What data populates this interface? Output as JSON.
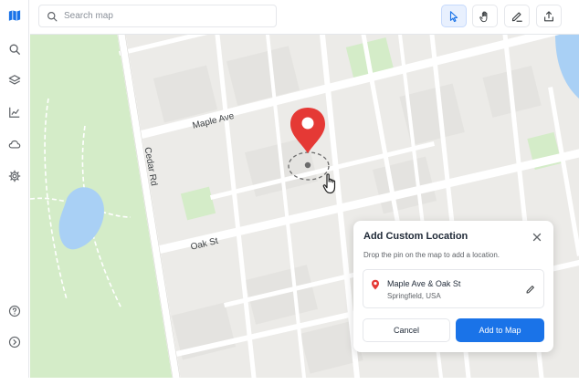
{
  "sidebar": {
    "items": [
      {
        "icon": "map-icon",
        "active": true
      },
      {
        "icon": "search-icon"
      },
      {
        "icon": "layers-icon"
      },
      {
        "icon": "analytics-icon"
      },
      {
        "icon": "cloud-icon"
      },
      {
        "icon": "settings-icon"
      },
      {
        "icon": "help-icon"
      },
      {
        "icon": "expand-icon"
      }
    ]
  },
  "toolbar": {
    "search_placeholder": "Search map",
    "tools": [
      {
        "icon": "pointer-icon",
        "active": true
      },
      {
        "icon": "pan-hand-icon"
      },
      {
        "icon": "draw-icon"
      },
      {
        "icon": "share-icon"
      }
    ]
  },
  "map": {
    "streets": {
      "maple": "Maple Ave",
      "cedar": "Cedar Rd",
      "oak": "Oak St"
    }
  },
  "dialog": {
    "title": "Add Custom Location",
    "subtitle": "Drop the pin on the map to add a location.",
    "location": {
      "name": "Maple Ave & Oak St",
      "city": "Springfield, USA"
    },
    "cancel_label": "Cancel",
    "confirm_label": "Add to Map"
  },
  "colors": {
    "accent": "#1a73e8",
    "pin": "#e53935",
    "park": "#cfe8c4",
    "water": "#a9d0f5",
    "road": "#ffffff",
    "block": "#e6e5e1"
  }
}
